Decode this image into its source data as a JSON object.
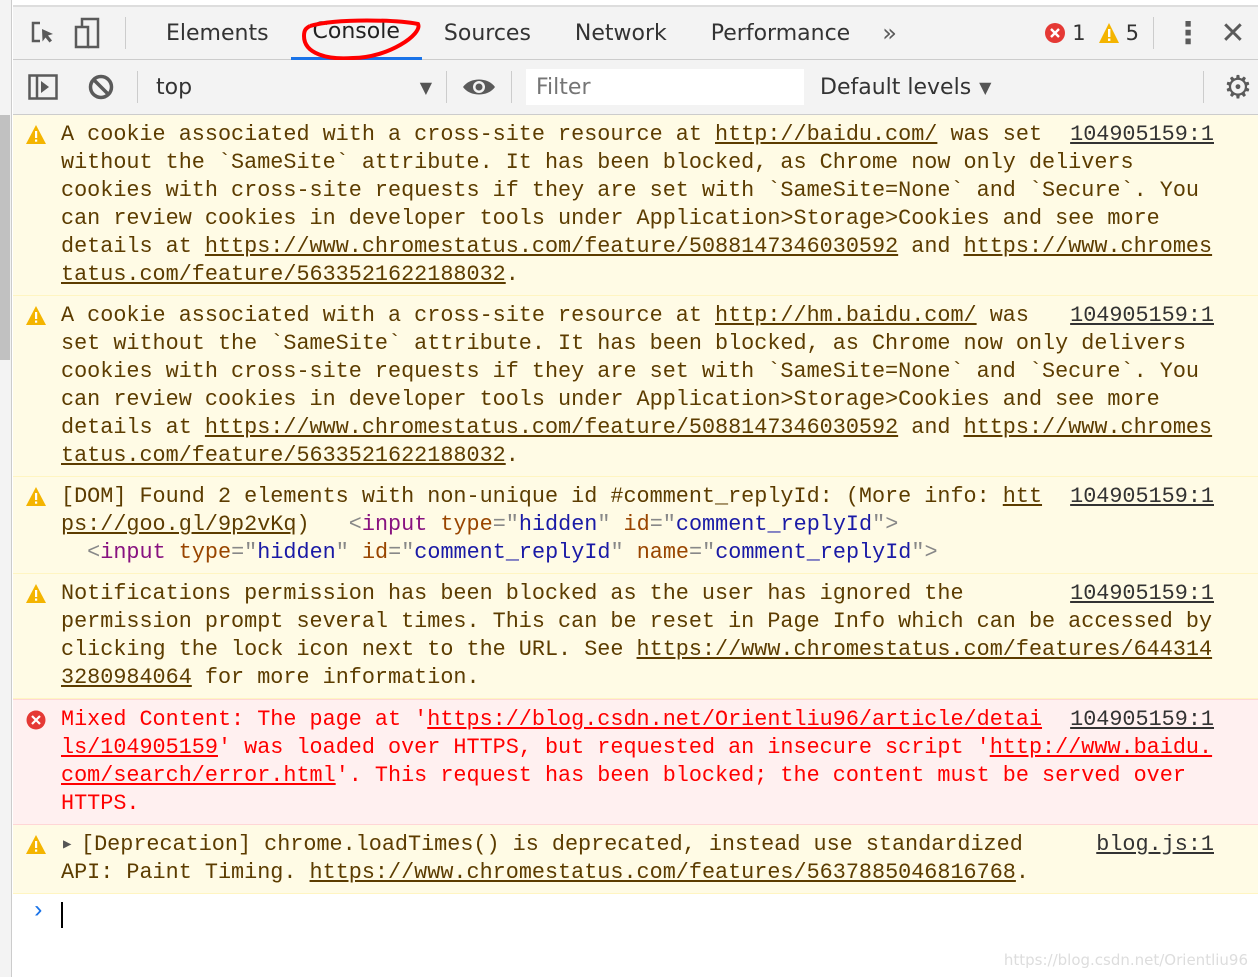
{
  "tabs": [
    "Elements",
    "Console",
    "Sources",
    "Network",
    "Performance"
  ],
  "active_tab": "Console",
  "counts": {
    "errors": "1",
    "warnings": "5"
  },
  "toolbar": {
    "context": "top",
    "filter_placeholder": "Filter",
    "levels": "Default levels"
  },
  "colors": {
    "accent": "#1a73e8",
    "warn_bg": "#fffbe5",
    "error_bg": "#fff0f0",
    "annotation": "#ff0000"
  },
  "messages": [
    {
      "level": "warning",
      "source": "104905159:1",
      "lines": [
        [
          {
            "t": "A cookie associated with a cross-site resource at "
          },
          {
            "l": "http://baidu.com/"
          },
          {
            "t": " was set"
          }
        ],
        [
          {
            "t": "without the `SameSite` attribute. It has been blocked, as Chrome now only delivers"
          }
        ],
        [
          {
            "t": "cookies with cross-site requests if they are set with `SameSite=None` and `Secure`. You"
          }
        ],
        [
          {
            "t": "can review cookies in developer tools under Application>Storage>Cookies and see more"
          }
        ],
        [
          {
            "t": "details at "
          },
          {
            "l": "https://www.chromestatus.com/feature/5088147346030592"
          },
          {
            "t": " and "
          },
          {
            "l": "https://www.chromes"
          }
        ],
        [
          {
            "l": "tatus.com/feature/5633521622188032"
          },
          {
            "t": "."
          }
        ]
      ]
    },
    {
      "level": "warning",
      "source": "104905159:1",
      "lines": [
        [
          {
            "t": "A cookie associated with a cross-site resource at "
          },
          {
            "l": "http://hm.baidu.com/"
          },
          {
            "t": " was"
          }
        ],
        [
          {
            "t": "set without the `SameSite` attribute. It has been blocked, as Chrome now only delivers"
          }
        ],
        [
          {
            "t": "cookies with cross-site requests if they are set with `SameSite=None` and `Secure`. You"
          }
        ],
        [
          {
            "t": "can review cookies in developer tools under Application>Storage>Cookies and see more"
          }
        ],
        [
          {
            "t": "details at "
          },
          {
            "l": "https://www.chromestatus.com/feature/5088147346030592"
          },
          {
            "t": " and "
          },
          {
            "l": "https://www.chromes"
          }
        ],
        [
          {
            "l": "tatus.com/feature/5633521622188032"
          },
          {
            "t": "."
          }
        ]
      ]
    },
    {
      "level": "warning",
      "source": "104905159:1",
      "lines": [
        [
          {
            "t": "[DOM] Found 2 elements with non-unique id #comment_replyId: (More info: "
          },
          {
            "l": "htt"
          }
        ],
        [
          {
            "l": "ps://goo.gl/9p2vKq"
          },
          {
            "t": ")   "
          },
          {
            "br": "<"
          },
          {
            "tg": "input"
          },
          {
            "t": " "
          },
          {
            "an": "type"
          },
          {
            "br": "=\""
          },
          {
            "av": "hidden"
          },
          {
            "br": "\""
          },
          {
            "t": " "
          },
          {
            "an": "id"
          },
          {
            "br": "=\""
          },
          {
            "av": "comment_replyId"
          },
          {
            "br": "\">"
          }
        ],
        [
          {
            "t": "  "
          },
          {
            "br": "<"
          },
          {
            "tg": "input"
          },
          {
            "t": " "
          },
          {
            "an": "type"
          },
          {
            "br": "=\""
          },
          {
            "av": "hidden"
          },
          {
            "br": "\""
          },
          {
            "t": " "
          },
          {
            "an": "id"
          },
          {
            "br": "=\""
          },
          {
            "av": "comment_replyId"
          },
          {
            "br": "\""
          },
          {
            "t": " "
          },
          {
            "an": "name"
          },
          {
            "br": "=\""
          },
          {
            "av": "comment_replyId"
          },
          {
            "br": "\">"
          }
        ]
      ]
    },
    {
      "level": "warning",
      "source": "104905159:1",
      "lines": [
        [
          {
            "t": "Notifications permission has been blocked as the user has ignored the"
          }
        ],
        [
          {
            "t": "permission prompt several times. This can be reset in Page Info which can be accessed by"
          }
        ],
        [
          {
            "t": "clicking the lock icon next to the URL. See "
          },
          {
            "l": "https://www.chromestatus.com/features/644314"
          }
        ],
        [
          {
            "l": "3280984064"
          },
          {
            "t": " for more information."
          }
        ]
      ]
    },
    {
      "level": "error",
      "source": "104905159:1",
      "lines": [
        [
          {
            "t": "Mixed Content: The page at '"
          },
          {
            "l": "https://blog.csdn.net/Orientliu96/article/detai"
          }
        ],
        [
          {
            "l": "ls/104905159"
          },
          {
            "t": "' was loaded over HTTPS, but requested an insecure script '"
          },
          {
            "l": "http://www.baidu."
          }
        ],
        [
          {
            "l": "com/search/error.html"
          },
          {
            "t": "'. This request has been blocked; the content must be served over"
          }
        ],
        [
          {
            "t": "HTTPS."
          }
        ]
      ]
    },
    {
      "level": "warning",
      "source": "blog.js:1",
      "expandable": true,
      "lines": [
        [
          {
            "t": "[Deprecation] chrome.loadTimes() is deprecated, instead use standardized"
          }
        ],
        [
          {
            "t": "API: Paint Timing. "
          },
          {
            "l": "https://www.chromestatus.com/features/5637885046816768"
          },
          {
            "t": "."
          }
        ]
      ]
    }
  ],
  "watermark": "https://blog.csdn.net/Orientliu96"
}
